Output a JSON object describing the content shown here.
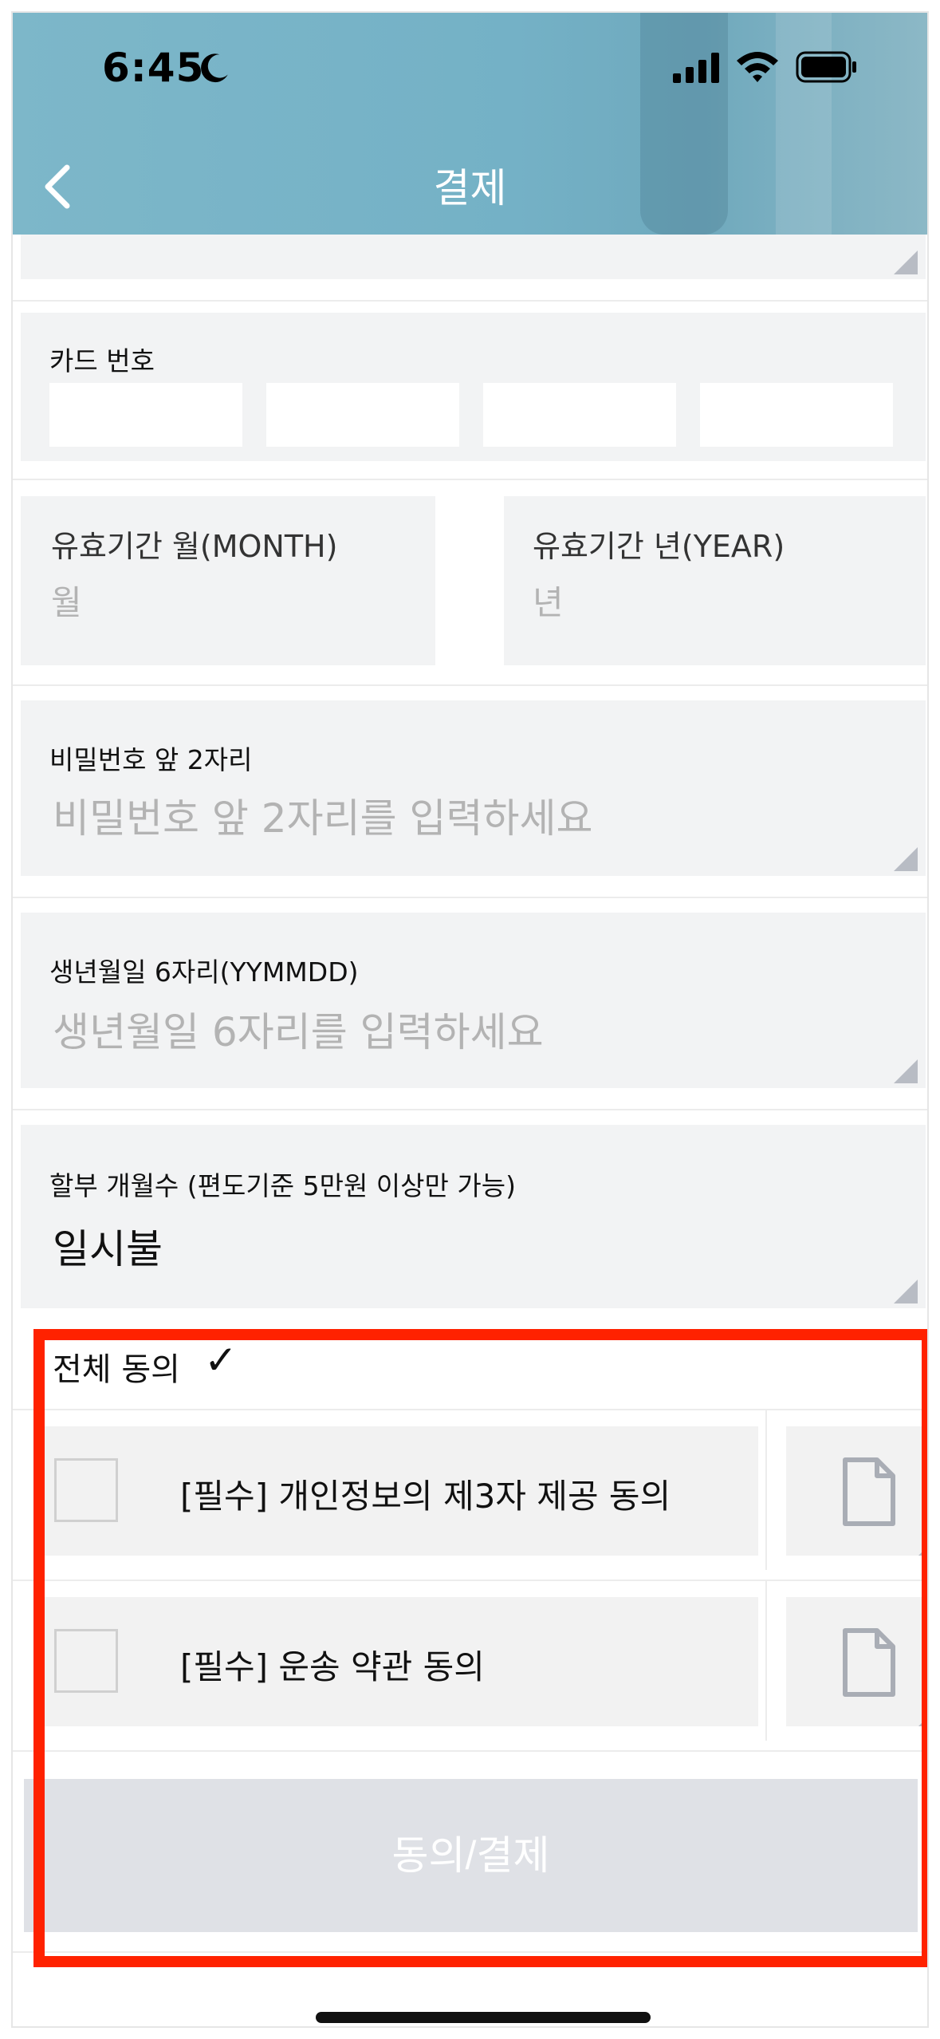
{
  "status_bar": {
    "time": "6:45"
  },
  "header": {
    "title": "결제"
  },
  "form": {
    "card_number_label": "카드 번호",
    "expiry_month_label": "유효기간 월(MONTH)",
    "expiry_month_placeholder": "월",
    "expiry_year_label": "유효기간 년(YEAR)",
    "expiry_year_placeholder": "년",
    "password_label": "비밀번호 앞 2자리",
    "password_placeholder": "비밀번호 앞 2자리를 입력하세요",
    "birth_label": "생년월일 6자리(YYMMDD)",
    "birth_placeholder": "생년월일 6자리를 입력하세요",
    "installment_label": "할부 개월수 (편도기준 5만원 이상만 가능)",
    "installment_value": "일시불"
  },
  "agreements": {
    "all_label": "전체 동의",
    "check_mark": "✓",
    "items": [
      {
        "label": "[필수] 개인정보의 제3자 제공 동의",
        "checked": false
      },
      {
        "label": "[필수] 운송 약관 동의",
        "checked": false
      }
    ]
  },
  "submit": {
    "label": "동의/결제"
  },
  "colors": {
    "header_bg": "#74b1c6",
    "field_bg": "#f2f3f4",
    "submit_bg": "#dfe1e6",
    "highlight": "#ff2200"
  }
}
